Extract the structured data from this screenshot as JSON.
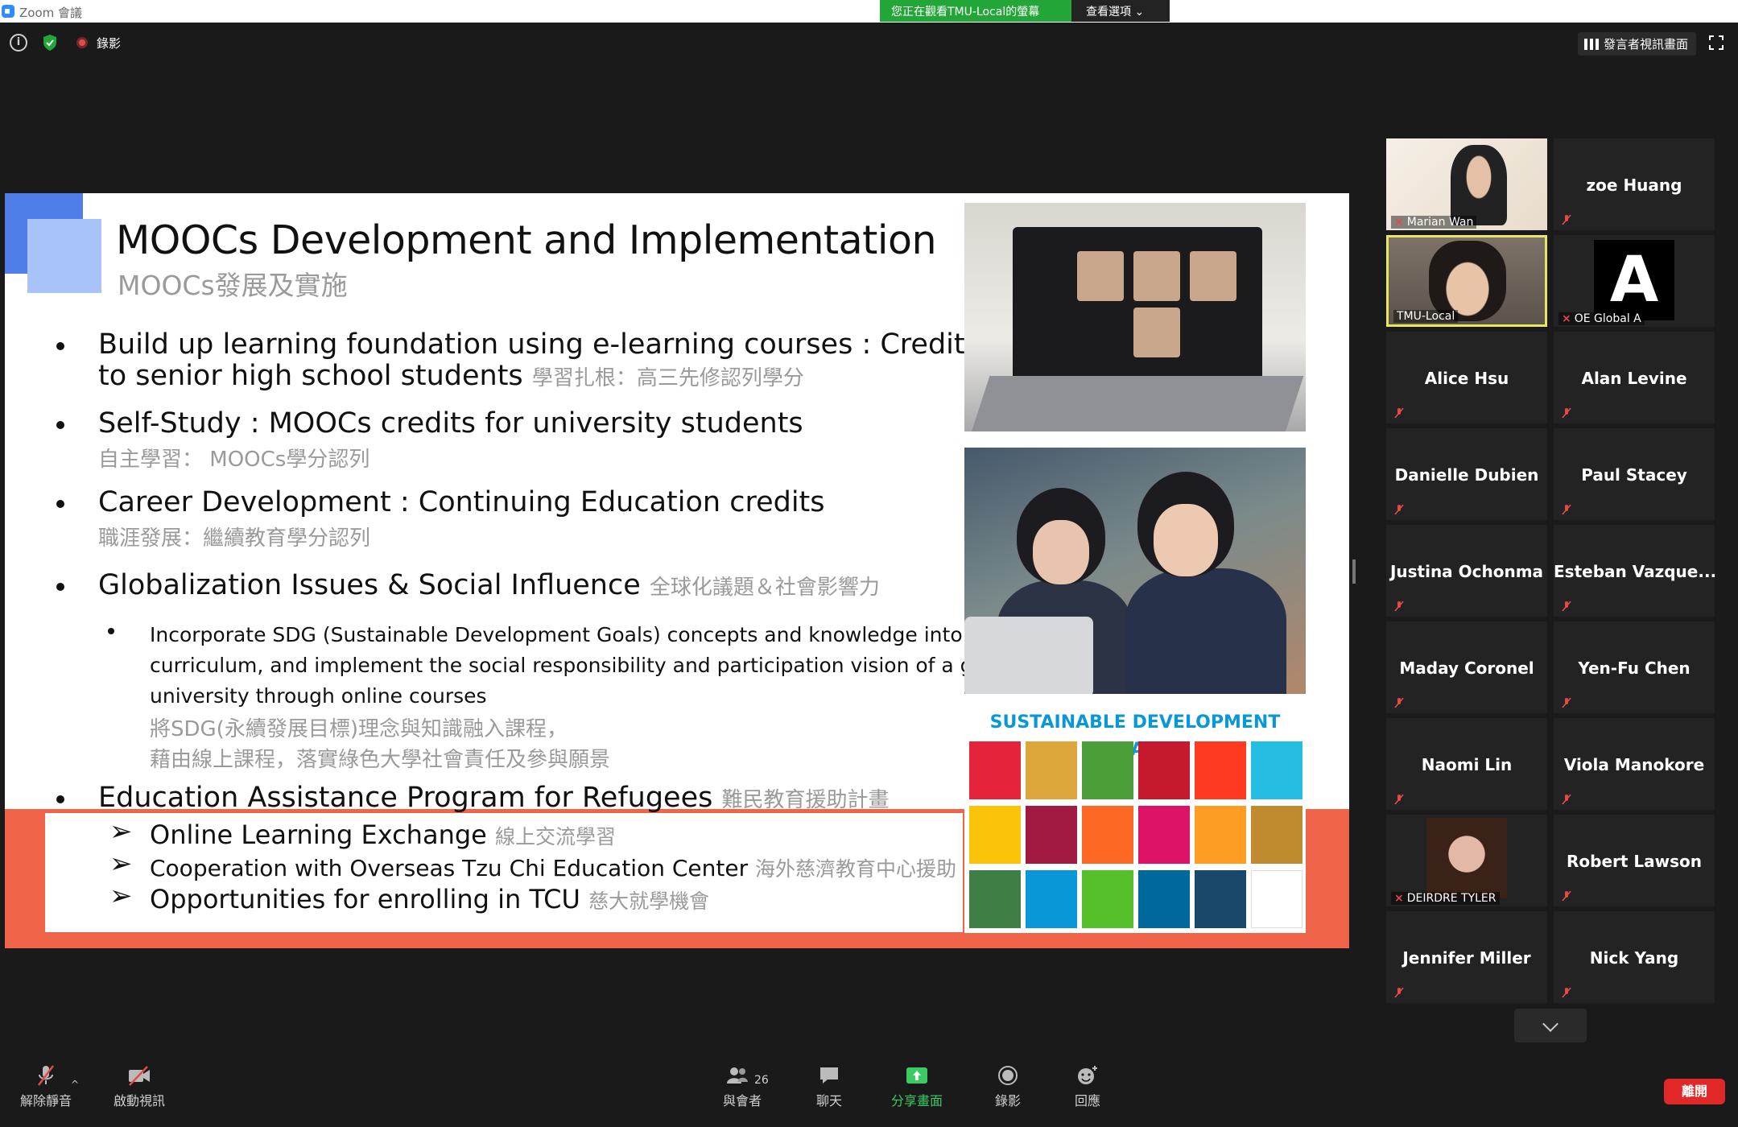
{
  "app": {
    "title": "Zoom 會議"
  },
  "banner": {
    "viewing": "您正在觀看TMU-Local的螢幕",
    "options": "查看選項 ⌄"
  },
  "top": {
    "recording": "錄影",
    "speaker_view": "發言者視訊畫面"
  },
  "slide": {
    "title": "MOOCs Development and Implementation",
    "subtitle": "MOOCs發展及實施",
    "b1_line1": "Build up learning  foundation using e-learning courses : Credits",
    "b1_line2": "to senior high school students",
    "b1_zh": "學習扎根：高三先修認列學分",
    "b2": "Self-Study : MOOCs credits for university students",
    "b2_zh": "自主學習：  MOOCs學分認列",
    "b3": "Career Development : Continuing Education credits",
    "b3_zh": "職涯發展：繼續教育學分認列",
    "b4": "Globalization Issues & Social Influence",
    "b4_zh": "全球化議題＆社會影響力",
    "sub1_l1": "Incorporate SDG (Sustainable Development Goals) concepts and knowledge into the",
    "sub1_l2": "curriculum, and implement the social responsibility and participation vision of a green",
    "sub1_l3": "university through online courses",
    "sub1_zh1": "將SDG(永續發展目標)理念與知識融入課程，",
    "sub1_zh2": "藉由線上課程，落實綠色大學社會責任及參與願景",
    "b5": "Education Assistance Program for Refugees",
    "b5_zh": "難民教育援助計畫",
    "a1": "Online Learning Exchange",
    "a1_zh": "線上交流學習",
    "a2": "Cooperation with Overseas Tzu Chi Education Center",
    "a2_zh": "海外慈濟教育中心援助",
    "a3": "Opportunities for enrolling in TCU",
    "a3_zh": "慈大就學機會",
    "sdg_header": "SUSTAINABLE DEVELOPMENT GOALS"
  },
  "participants": [
    {
      "name": "Marian Wan",
      "video": true
    },
    {
      "name": "zoe Huang",
      "video": false
    },
    {
      "name": "TMU-Local",
      "video": true,
      "active": true
    },
    {
      "name": "OE Global A",
      "video": true
    },
    {
      "name": "Alice Hsu",
      "video": false
    },
    {
      "name": "Alan Levine",
      "video": false
    },
    {
      "name": "Danielle Dubien",
      "video": false
    },
    {
      "name": "Paul Stacey",
      "video": false
    },
    {
      "name": "Justina Ochonma",
      "video": false
    },
    {
      "name": "Esteban  Vazque...",
      "video": false
    },
    {
      "name": "Maday Coronel",
      "video": false
    },
    {
      "name": "Yen-Fu Chen",
      "video": false
    },
    {
      "name": "Naomi Lin",
      "video": false
    },
    {
      "name": "Viola Manokore",
      "video": false
    },
    {
      "name": "DEIRDRE TYLER",
      "video": true
    },
    {
      "name": "Robert Lawson",
      "video": false
    },
    {
      "name": "Jennifer Miller",
      "video": false
    },
    {
      "name": "Nick Yang",
      "video": false
    }
  ],
  "toolbar": {
    "unmute": "解除靜音",
    "start_video": "啟動視訊",
    "participants": "與會者",
    "participants_count": "26",
    "chat": "聊天",
    "share": "分享畫面",
    "record": "錄影",
    "reactions": "回應",
    "leave": "離開"
  },
  "colors": {
    "accent_green": "#23a638",
    "leave_red": "#e02828",
    "slide_orange": "#f0654a",
    "active_border": "#e9e56b"
  }
}
